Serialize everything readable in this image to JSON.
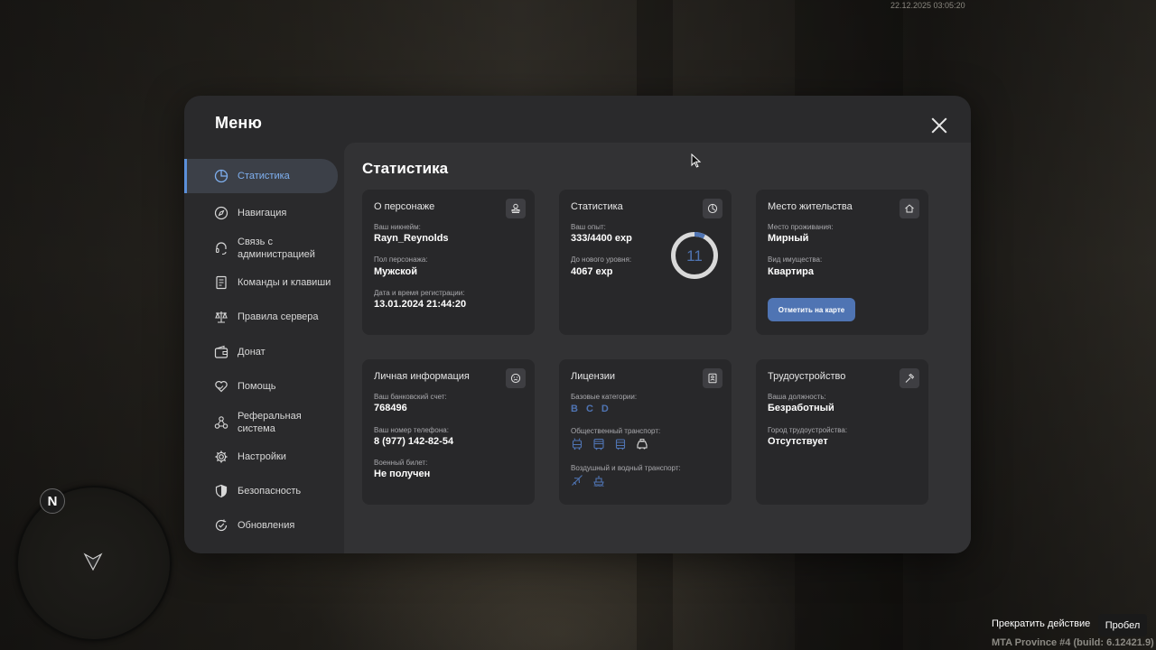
{
  "hud": {
    "timestamp": "22.12.2025 03:05:20",
    "compass_letter": "N",
    "action_text": "Прекратить действие",
    "action_key": "Пробел",
    "build_info": "MTA Province #4 (build: 6.12421.9)"
  },
  "menu": {
    "title": "Меню",
    "sidebar": [
      {
        "label": "Статистика",
        "icon": "stats-icon",
        "active": true
      },
      {
        "label": "Навигация",
        "icon": "compass-icon"
      },
      {
        "label": "Связь с\nадминистрацией",
        "icon": "headset-icon"
      },
      {
        "label": "Команды и клавиши",
        "icon": "document-icon"
      },
      {
        "label": "Правила сервера",
        "icon": "scales-icon"
      },
      {
        "label": "Донат",
        "icon": "wallet-icon"
      },
      {
        "label": "Помощь",
        "icon": "heart-hands-icon"
      },
      {
        "label": "Реферальная\nсистема",
        "icon": "network-icon"
      },
      {
        "label": "Настройки",
        "icon": "gear-icon"
      },
      {
        "label": "Безопасность",
        "icon": "shield-icon"
      },
      {
        "label": "Обновления",
        "icon": "refresh-check-icon"
      }
    ]
  },
  "content": {
    "title": "Статистика",
    "character": {
      "title": "О персонаже",
      "nickname_label": "Ваш никнейм:",
      "nickname": "Rayn_Reynolds",
      "gender_label": "Пол персонажа:",
      "gender": "Мужской",
      "reg_label": "Дата и время регистрации:",
      "reg": "13.01.2024 21:44:20"
    },
    "stats": {
      "title": "Статистика",
      "exp_label": "Ваш опыт:",
      "exp": "333/4400 exp",
      "next_label": "До нового уровня:",
      "next": "4067 exp",
      "level": "11",
      "progress": 0.0757
    },
    "residence": {
      "title": "Место жительства",
      "place_label": "Место проживания:",
      "place": "Мирный",
      "type_label": "Вид имущества:",
      "type": "Квартира",
      "map_button": "Отметить на карте"
    },
    "personal": {
      "title": "Личная информация",
      "bank_label": "Ваш банковский счет:",
      "bank": "768496",
      "phone_label": "Ваш номер телефона:",
      "phone": "8 (977) 142-82-54",
      "military_label": "Военный билет:",
      "military": "Не получен"
    },
    "licenses": {
      "title": "Лицензии",
      "base_label": "Базовые категории:",
      "base": [
        "B",
        "C",
        "D"
      ],
      "public_label": "Общественный транспорт:",
      "air_label": "Воздушный и водный транспорт:"
    },
    "employment": {
      "title": "Трудоустройство",
      "position_label": "Ваша должность:",
      "position": "Безработный",
      "city_label": "Город трудоустройства:",
      "city": "Отсутствует"
    }
  },
  "colors": {
    "accent": "#4f74b3",
    "active_text": "#7fb0f0"
  }
}
